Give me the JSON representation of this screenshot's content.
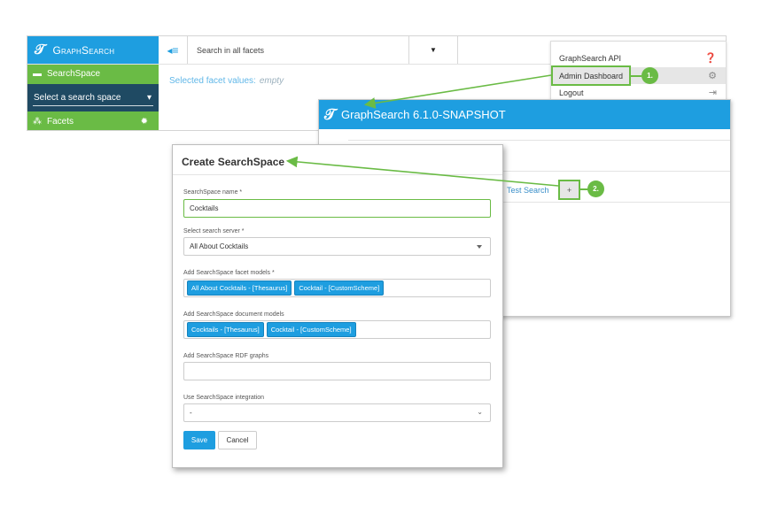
{
  "app": {
    "brand": "GraphSearch",
    "sidebar": {
      "searchspace_label": "SearchSpace",
      "select_placeholder": "Select a search space",
      "facets_label": "Facets"
    },
    "search_placeholder": "Search in all facets",
    "facet_values_label": "Selected facet values:",
    "facet_values_empty": "empty"
  },
  "user_menu": {
    "items": [
      {
        "label": "GraphSearch API",
        "icon": "question-circle-icon"
      },
      {
        "label": "Admin Dashboard",
        "icon": "gear-icon"
      },
      {
        "label": "Logout",
        "icon": "logout-icon"
      }
    ]
  },
  "admin_window": {
    "title": "GraphSearch 6.1.0-SNAPSHOT",
    "test_search_link": "Test Search",
    "add_button": "+"
  },
  "steps": [
    "1.",
    "2."
  ],
  "dialog": {
    "title": "Create SearchSpace",
    "name_label": "SearchSpace name *",
    "name_value": "Cocktails",
    "server_label": "Select search server *",
    "server_value": "All About Cocktails",
    "facet_models_label": "Add SearchSpace facet models *",
    "facet_models": [
      "All About Cocktails - [Thesaurus]",
      "Cocktail - [CustomScheme]"
    ],
    "document_models_label": "Add SearchSpace document models",
    "document_models": [
      "Cocktails - [Thesaurus]",
      "Cocktail - [CustomScheme]"
    ],
    "rdf_graphs_label": "Add SearchSpace RDF graphs",
    "rdf_graphs_value": "",
    "integration_label": "Use SearchSpace integration",
    "integration_value": "-",
    "save_label": "Save",
    "cancel_label": "Cancel"
  },
  "colors": {
    "brand_blue": "#1e9ee0",
    "brand_green": "#6abb45",
    "sidebar_dark": "#1f4a63"
  }
}
